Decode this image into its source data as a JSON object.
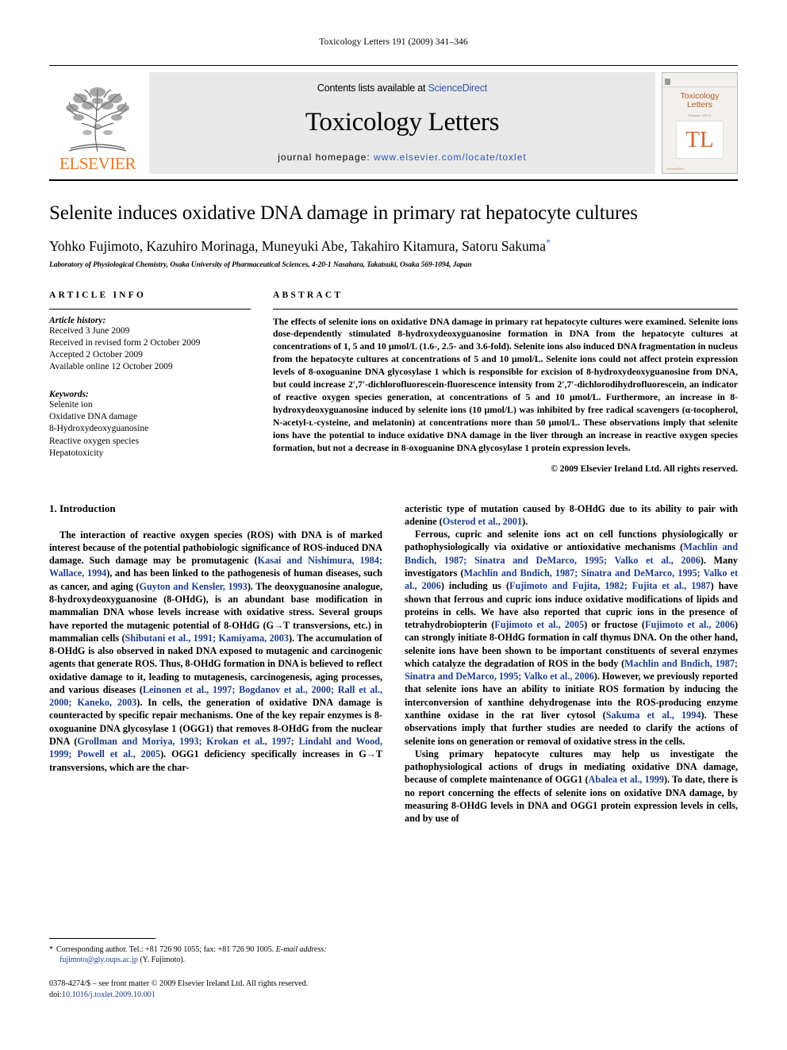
{
  "running_head": "Toxicology Letters 191 (2009) 341–346",
  "banner": {
    "publisher_name": "ELSEVIER",
    "contents_prefix": "Contents lists available at ",
    "contents_link": "ScienceDirect",
    "journal_title": "Toxicology Letters",
    "homepage_label": "journal homepage:",
    "homepage_url": "www.elsevier.com/locate/toxlet",
    "cover": {
      "title_line1": "Toxicology",
      "title_line2": "Letters",
      "subtitle": "Volume 191/3",
      "monogram": "TL",
      "footer": "ScienceDirect"
    }
  },
  "article": {
    "title": "Selenite induces oxidative DNA damage in primary rat hepatocyte cultures",
    "authors": "Yohko Fujimoto, Kazuhiro Morinaga, Muneyuki Abe, Takahiro Kitamura, Satoru Sakuma",
    "author_marker": "*",
    "affiliation": "Laboratory of Physiological Chemistry, Osaka University of Pharmaceutical Sciences, 4-20-1 Nasahara, Takatsuki, Osaka 569-1094, Japan"
  },
  "article_info": {
    "heading": "ARTICLE INFO",
    "history_label": "Article history:",
    "history": [
      "Received 3 June 2009",
      "Received in revised form 2 October 2009",
      "Accepted 2 October 2009",
      "Available online 12 October 2009"
    ],
    "keywords_label": "Keywords:",
    "keywords": [
      "Selenite ion",
      "Oxidative DNA damage",
      "8-Hydroxydeoxyguanosine",
      "Reactive oxygen species",
      "Hepatotoxicity"
    ]
  },
  "abstract": {
    "heading": "ABSTRACT",
    "text": "The effects of selenite ions on oxidative DNA damage in primary rat hepatocyte cultures were examined. Selenite ions dose-dependently stimulated 8-hydroxydeoxyguanosine formation in DNA from the hepatocyte cultures at concentrations of 1, 5 and 10 μmol/L (1.6-, 2.5- and 3.6-fold). Selenite ions also induced DNA fragmentation in nucleus from the hepatocyte cultures at concentrations of 5 and 10 μmol/L. Selenite ions could not affect protein expression levels of 8-oxoguanine DNA glycosylase 1 which is responsible for excision of 8-hydroxydeoxyguanosine from DNA, but could increase 2′,7′-dichlorofluorescein-fluorescence intensity from 2′,7′-dichlorodihydrofluorescein, an indicator of reactive oxygen species generation, at concentrations of 5 and 10 μmol/L. Furthermore, an increase in 8-hydroxydeoxyguanosine induced by selenite ions (10 μmol/L) was inhibited by free radical scavengers (α-tocopherol, N-acetyl-ʟ-cysteine, and melatonin) at concentrations more than 50 μmol/L. These observations imply that selenite ions have the potential to induce oxidative DNA damage in the liver through an increase in reactive oxygen species formation, but not a decrease in 8-oxoguanine DNA glycosylase 1 protein expression levels.",
    "copyright": "© 2009 Elsevier Ireland Ltd. All rights reserved."
  },
  "introduction": {
    "heading": "1.  Introduction",
    "left_p1_a": "The interaction of reactive oxygen species (ROS) with DNA is of marked interest because of the potential pathobiologic significance of ROS-induced DNA damage. Such damage may be promutagenic (",
    "left_p1_c1": "Kasai and Nishimura, 1984; Wallace, 1994",
    "left_p1_b": "), and has been linked to the pathogenesis of human diseases, such as cancer, and aging (",
    "left_p1_c2": "Guyton and Kensler, 1993",
    "left_p1_c": "). The deoxyguanosine analogue, 8-hydroxydeoxyguanosine (8-OHdG), is an abundant base modification in mammalian DNA whose levels increase with oxidative stress. Several groups have reported the mutagenic potential of 8-OHdG (G→T transversions, etc.) in mammalian cells (",
    "left_p1_c3": "Shibutani et al., 1991; Kamiyama, 2003",
    "left_p1_d": "). The accumulation of 8-OHdG is also observed in naked DNA exposed to mutagenic and carcinogenic agents that generate ROS. Thus, 8-OHdG formation in DNA is believed to reflect oxidative damage to it, leading to mutagenesis, carcinogenesis, aging processes, and various diseases (",
    "left_p1_c4": "Leinonen et al., 1997; Bogdanov et al., 2000; Rall et al., 2000; Kaneko, 2003",
    "left_p1_e": "). In cells, the generation of oxidative DNA damage is counteracted by specific repair mechanisms. One of the key repair enzymes is 8-oxoguanine DNA glycosylase 1 (OGG1) that removes 8-OHdG from the nuclear DNA (",
    "left_p1_c5": "Grollman and Moriya, 1993; Krokan et al., 1997; Lindahl and Wood, 1999; Powell et al., 2005",
    "left_p1_f": "). OGG1 deficiency specifically increases in G→T transversions, which are the char-",
    "right_p1_a": "acteristic type of mutation caused by 8-OHdG due to its ability to pair with adenine (",
    "right_p1_c1": "Osterod et al., 2001",
    "right_p1_b": ").",
    "right_p2_a": "Ferrous, cupric and selenite ions act on cell functions physiologically or pathophysiologically via oxidative or antioxidative mechanisms (",
    "right_p2_c1": "Machlin and Bndich, 1987; Sinatra and DeMarco, 1995; Valko et al., 2006",
    "right_p2_b": "). Many investigators (",
    "right_p2_c2": "Machlin and Bndich, 1987; Sinatra and DeMarco, 1995; Valko et al., 2006",
    "right_p2_c": ") including us (",
    "right_p2_c3": "Fujimoto and Fujita, 1982; Fujita et al., 1987",
    "right_p2_d": ") have shown that ferrous and cupric ions induce oxidative modifications of lipids and proteins in cells. We have also reported that cupric ions in the presence of tetrahydrobiopterin (",
    "right_p2_c4": "Fujimoto et al., 2005",
    "right_p2_e": ") or fructose (",
    "right_p2_c5": "Fujimoto et al., 2006",
    "right_p2_f": ") can strongly initiate 8-OHdG formation in calf thymus DNA. On the other hand, selenite ions have been shown to be important constituents of several enzymes which catalyze the degradation of ROS in the body (",
    "right_p2_c6": "Machlin and Bndich, 1987; Sinatra and DeMarco, 1995; Valko et al., 2006",
    "right_p2_g": "). However, we previously reported that selenite ions have an ability to initiate ROS formation by inducing the interconversion of xanthine dehydrogenase into the ROS-producing enzyme xanthine oxidase in the rat liver cytosol (",
    "right_p2_c7": "Sakuma et al., 1994",
    "right_p2_h": "). These observations imply that further studies are needed to clarify the actions of selenite ions on generation or removal of oxidative stress in the cells.",
    "right_p3_a": "Using primary hepatocyte cultures may help us investigate the pathophysiological actions of drugs in mediating oxidative DNA damage, because of complete maintenance of OGG1 (",
    "right_p3_c1": "Abalea et al., 1999",
    "right_p3_b": "). To date, there is no report concerning the effects of selenite ions on oxidative DNA damage, by measuring 8-OHdG levels in DNA and OGG1 protein expression levels in cells, and by use of"
  },
  "footnotes": {
    "star": "*",
    "corresponding": "Corresponding author. Tel.: +81 726 90 1055; fax: +81 726 90 1005.",
    "email_label": "E-mail address:",
    "email": "fujimoto@gly.oups.ac.jp",
    "email_suffix": "(Y. Fujimoto).",
    "issn_line": "0378-4274/$ – see front matter © 2009 Elsevier Ireland Ltd. All rights reserved.",
    "doi_label": "doi:",
    "doi_value": "10.1016/j.toxlet.2009.10.001"
  },
  "colors": {
    "link": "#2b56b5",
    "citation": "#1c3d8f",
    "elsevier_orange": "#E87722",
    "banner_bg": "#e9e9e9"
  }
}
